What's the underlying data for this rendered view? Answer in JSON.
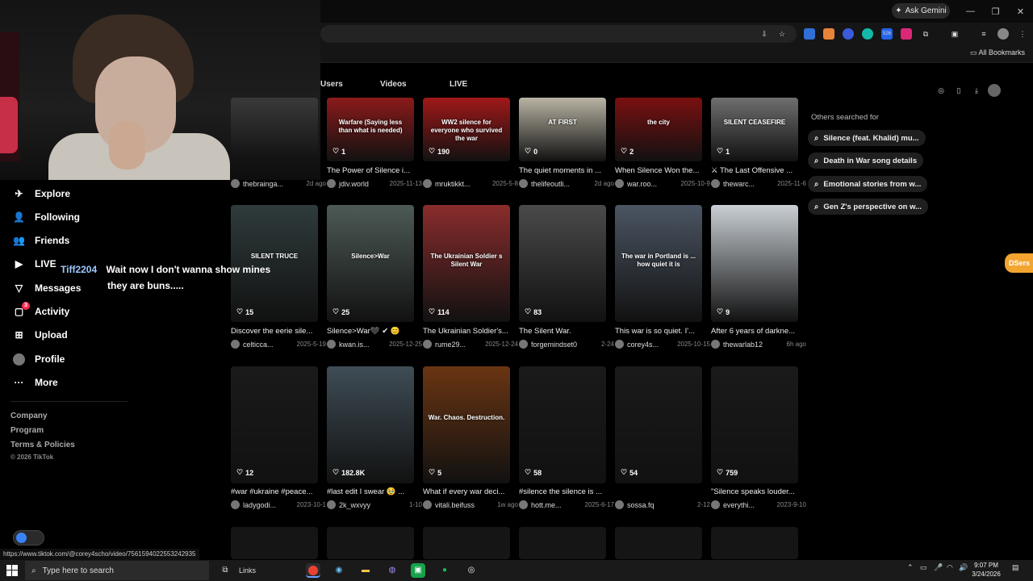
{
  "browser": {
    "ask_gemini": "Ask Gemini",
    "all_bookmarks": "All Bookmarks",
    "status_url": "https://www.tiktok.com/@corey4scho/video/7561594022553242935",
    "ext_badge": "526"
  },
  "tabs": [
    {
      "label": "Users"
    },
    {
      "label": "Videos"
    },
    {
      "label": "LIVE"
    }
  ],
  "sidebar": {
    "items": [
      {
        "label": "Explore",
        "icon": "compass-icon"
      },
      {
        "label": "Following",
        "icon": "user-icon"
      },
      {
        "label": "Friends",
        "icon": "friends-icon"
      },
      {
        "label": "LIVE",
        "icon": "live-icon"
      },
      {
        "label": "Messages",
        "icon": "send-icon"
      },
      {
        "label": "Activity",
        "icon": "activity-icon",
        "badge": "3"
      },
      {
        "label": "Upload",
        "icon": "plus-square-icon"
      },
      {
        "label": "Profile",
        "icon": "profile-avatar"
      },
      {
        "label": "More",
        "icon": "more-icon"
      }
    ],
    "footer": {
      "company": "Company",
      "program": "Program",
      "terms": "Terms & Policies",
      "copyright": "© 2026 TikTok"
    }
  },
  "chat": {
    "user": "Tiff2204",
    "line1": "Wait now I don't wanna show mines",
    "line2": "they are buns....."
  },
  "others_searched": {
    "title": "Others searched for",
    "items": [
      "Silence (feat. Khalid) mu...",
      "Death in War song details",
      "Emotional stories from w...",
      "Gen Z's perspective on w..."
    ]
  },
  "videos_row1": [
    {
      "likes": "",
      "caption": "",
      "user": "thebrainga...",
      "date": "2d ago",
      "thumb_text": ""
    },
    {
      "likes": "1",
      "caption": "The Power of Silence i...",
      "user": "jdiv.world",
      "date": "2025-11-13",
      "thumb_text": "Warfare (Saying less than what is needed)"
    },
    {
      "likes": "190",
      "caption": "",
      "user": "mruktikkt...",
      "date": "2025-5-8",
      "thumb_text": "WW2 silence for everyone who survived the war"
    },
    {
      "likes": "0",
      "caption": "The quiet moments in ...",
      "user": "thelifeoutli...",
      "date": "2d ago",
      "thumb_text": "AT FIRST"
    },
    {
      "likes": "2",
      "caption": "When Silence Won the...",
      "user": "war.roo...",
      "date": "2025-10-9",
      "thumb_text": "the city"
    },
    {
      "likes": "1",
      "caption": "⚔ The Last Offensive ...",
      "user": "thewarc...",
      "date": "2025-11-6",
      "thumb_text": "SILENT CEASEFIRE"
    }
  ],
  "videos_row2": [
    {
      "likes": "15",
      "caption": "Discover the eerie sile...",
      "user": "celticca...",
      "date": "2025-5-19",
      "thumb_text": "SILENT TRUCE"
    },
    {
      "likes": "25",
      "caption": "Silence>War🖤 ✔ 😊",
      "user": "kwan.is...",
      "date": "2025-12-25",
      "thumb_text": "Silence>War"
    },
    {
      "likes": "114",
      "caption": "The Ukrainian Soldier's...",
      "user": "rume29...",
      "date": "2025-12-24",
      "thumb_text": "The Ukrainian Soldier s Silent War"
    },
    {
      "likes": "83",
      "caption": "The Silent War.",
      "user": "forgemindset0",
      "date": "2-24",
      "thumb_text": ""
    },
    {
      "likes": "",
      "caption": "This war is so quiet. I'...",
      "user": "corey4s...",
      "date": "2025-10-15",
      "thumb_text": "The war in Portland is ... how quiet it is"
    },
    {
      "likes": "9",
      "caption": "After 6 years of darkne...",
      "user": "thewarlab12",
      "date": "6h ago",
      "thumb_text": ""
    }
  ],
  "videos_row3": [
    {
      "likes": "12",
      "caption": "#war #ukraine #peace...",
      "user": "ladygodi...",
      "date": "2023-10-1",
      "thumb_text": ""
    },
    {
      "likes": "182.8K",
      "caption": "#last edit I swear 🥹 ...",
      "user": "2k_wxvyy",
      "date": "1-10",
      "thumb_text": ""
    },
    {
      "likes": "5",
      "caption": "What if every war deci...",
      "user": "vitali.beifuss",
      "date": "1w ago",
      "thumb_text": "War. Chaos. Destruction."
    },
    {
      "likes": "58",
      "caption": "#silence the silence is ...",
      "user": "hott.me...",
      "date": "2025-6-17",
      "thumb_text": ""
    },
    {
      "likes": "54",
      "caption": "",
      "user": "sossa.fq",
      "date": "2-12",
      "thumb_text": ""
    },
    {
      "likes": "759",
      "caption": "\"Silence speaks louder...",
      "user": "everythi...",
      "date": "2023-9-10",
      "thumb_text": ""
    }
  ],
  "dsers": "DSers",
  "taskbar": {
    "search_placeholder": "Type here to search",
    "links": "Links",
    "time": "9:07 PM",
    "date": "3/24/2026"
  }
}
